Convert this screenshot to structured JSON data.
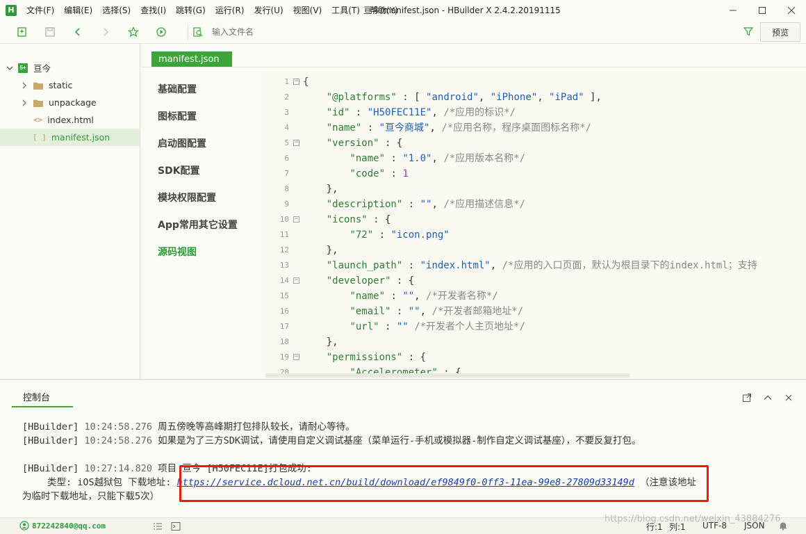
{
  "app": {
    "logo": "H",
    "window_title": "亘今/manifest.json - HBuilder X 2.4.2.20191115"
  },
  "menu": [
    "文件(F)",
    "编辑(E)",
    "选择(S)",
    "查找(I)",
    "跳转(G)",
    "运行(R)",
    "发行(U)",
    "视图(V)",
    "工具(T)",
    "帮助(Y)"
  ],
  "toolbar": {
    "search_placeholder": "输入文件名",
    "preview_label": "预览"
  },
  "sidebar": {
    "project": "亘今",
    "items": [
      {
        "label": "static",
        "type": "folder"
      },
      {
        "label": "unpackage",
        "type": "folder"
      },
      {
        "label": "index.html",
        "type": "html"
      },
      {
        "label": "manifest.json",
        "type": "json",
        "selected": true
      }
    ]
  },
  "editor_tab": "manifest.json",
  "config_nav": [
    "基础配置",
    "图标配置",
    "启动图配置",
    "SDK配置",
    "模块权限配置",
    "App常用其它设置",
    "源码视图"
  ],
  "config_nav_active": "源码视图",
  "code_lines": [
    {
      "n": "1",
      "fold": true,
      "html": "<span class=\"p\">{</span>"
    },
    {
      "n": "2",
      "fold": false,
      "html": "    <span class=\"k\">\"@platforms\"</span> : [ <span class=\"s\">\"android\"</span>, <span class=\"s\">\"iPhone\"</span>, <span class=\"s\">\"iPad\"</span> ],"
    },
    {
      "n": "3",
      "fold": false,
      "html": "    <span class=\"k\">\"id\"</span> : <span class=\"s\">\"H50FEC11E\"</span>, <span class=\"c\">/*应用的标识*/</span>"
    },
    {
      "n": "4",
      "fold": false,
      "html": "    <span class=\"k\">\"name\"</span> : <span class=\"s\">\"亘今商城\"</span>, <span class=\"c\">/*应用名称，程序桌面图标名称*/</span>"
    },
    {
      "n": "5",
      "fold": true,
      "html": "    <span class=\"k\">\"version\"</span> : {"
    },
    {
      "n": "6",
      "fold": false,
      "html": "        <span class=\"k\">\"name\"</span> : <span class=\"s\">\"1.0\"</span>, <span class=\"c\">/*应用版本名称*/</span>"
    },
    {
      "n": "7",
      "fold": false,
      "html": "        <span class=\"k\">\"code\"</span> : <span class=\"n\">1</span>"
    },
    {
      "n": "8",
      "fold": false,
      "html": "    },"
    },
    {
      "n": "9",
      "fold": false,
      "html": "    <span class=\"k\">\"description\"</span> : <span class=\"s\">\"\"</span>, <span class=\"c\">/*应用描述信息*/</span>"
    },
    {
      "n": "10",
      "fold": true,
      "html": "    <span class=\"k\">\"icons\"</span> : {"
    },
    {
      "n": "11",
      "fold": false,
      "html": "        <span class=\"k\">\"72\"</span> : <span class=\"s\">\"icon.png\"</span>"
    },
    {
      "n": "12",
      "fold": false,
      "html": "    },"
    },
    {
      "n": "13",
      "fold": false,
      "html": "    <span class=\"k\">\"launch_path\"</span> : <span class=\"s\">\"index.html\"</span>, <span class=\"c\">/*应用的入口页面，默认为根目录下的index.html；支持</span>"
    },
    {
      "n": "14",
      "fold": true,
      "html": "    <span class=\"k\">\"developer\"</span> : {"
    },
    {
      "n": "15",
      "fold": false,
      "html": "        <span class=\"k\">\"name\"</span> : <span class=\"s\">\"\"</span>, <span class=\"c\">/*开发者名称*/</span>"
    },
    {
      "n": "16",
      "fold": false,
      "html": "        <span class=\"k\">\"email\"</span> : <span class=\"s\">\"\"</span>, <span class=\"c\">/*开发者邮箱地址*/</span>"
    },
    {
      "n": "17",
      "fold": false,
      "html": "        <span class=\"k\">\"url\"</span> : <span class=\"s\">\"\"</span> <span class=\"c\">/*开发者个人主页地址*/</span>"
    },
    {
      "n": "18",
      "fold": false,
      "html": "    },"
    },
    {
      "n": "19",
      "fold": true,
      "html": "    <span class=\"k\">\"permissions\"</span> : {"
    },
    {
      "n": "20",
      "fold": false,
      "html": "        <span class=\"k\">\"Accelerometer\"</span> : {"
    }
  ],
  "console": {
    "tab": "控制台",
    "lines": [
      {
        "src": "[HBuilder]",
        "time": "10:24:58.276",
        "msg": "周五傍晚等高峰期打包排队较长，请耐心等待。"
      },
      {
        "src": "[HBuilder]",
        "time": "10:24:58.276",
        "msg": "如果是为了三方SDK调试，请使用自定义调试基座（菜单运行-手机或模拟器-制作自定义调试基座），不要反复打包。"
      },
      {
        "src": "[HBuilder]",
        "time": "10:27:14.820",
        "msg": "项目 亘今 [H50FEC11E]打包成功:"
      }
    ],
    "result_prefix": "类型: iOS越狱包 下载地址: ",
    "download_url": "https://service.dcloud.net.cn/build/download/ef9849f0-0ff3-11ea-99e8-27809d33149d",
    "result_suffix": "（注意该地址",
    "result_line2": "为临时下载地址，只能下载5次）"
  },
  "status": {
    "account": "872242840@qq.com",
    "row": "行:1",
    "col": "列:1",
    "encoding": "UTF-8",
    "syntax": "JSON",
    "watermark": "https://blog.csdn.net/weixin_43884276"
  },
  "colors": {
    "accent": "#3ca53a",
    "highlight_box": "#e81a1a",
    "link": "#1a3fa8"
  }
}
